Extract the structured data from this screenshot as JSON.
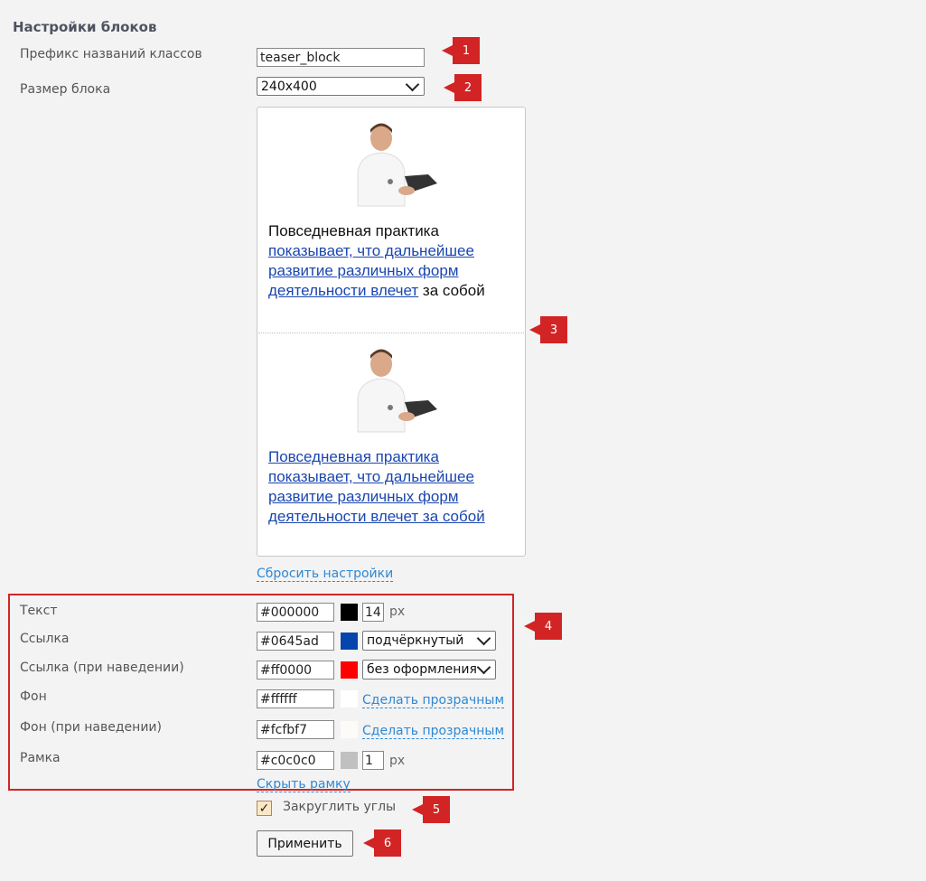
{
  "heading": "Настройки блоков",
  "prefix": {
    "label": "Префикс названий классов",
    "value": "teaser_block"
  },
  "size": {
    "label": "Размер блока",
    "value": "240x400"
  },
  "preview": {
    "teaser1": {
      "text": "Повседневная практика",
      "link": "показывает, что дальнейшее развитие различных форм деятельности влечет",
      "tail": "за собой"
    },
    "teaser2": {
      "link": "Повседневная практика показывает, что дальнейшее развитие различных форм деятельности влечет за собой"
    }
  },
  "reset_link": "Сбросить настройки",
  "colors": {
    "text": {
      "label": "Текст",
      "value": "#000000",
      "swatch": "#000000",
      "size": "14",
      "unit": "px"
    },
    "link": {
      "label": "Ссылка",
      "value": "#0645ad",
      "swatch": "#0645ad",
      "decoration": "подчёркнутый"
    },
    "link_hover": {
      "label": "Ссылка (при наведении)",
      "value": "#ff0000",
      "swatch": "#ff0000",
      "decoration": "без оформления"
    },
    "bg": {
      "label": "Фон",
      "value": "#ffffff",
      "swatch": "#ffffff",
      "transparent_link": "Сделать прозрачным"
    },
    "bg_hover": {
      "label": "Фон (при наведении)",
      "value": "#fcfbf7",
      "swatch": "#fcfbf7",
      "transparent_link": "Сделать прозрачным"
    },
    "border": {
      "label": "Рамка",
      "value": "#c0c0c0",
      "swatch": "#c0c0c0",
      "width": "1",
      "unit": "px",
      "hide_link": "Скрыть рамку"
    }
  },
  "rounded": {
    "label": "Закруглить углы",
    "checked": true,
    "mark": "✓"
  },
  "apply_button": "Применить",
  "badges": [
    "1",
    "2",
    "3",
    "4",
    "5",
    "6"
  ],
  "accent": "#d22424"
}
